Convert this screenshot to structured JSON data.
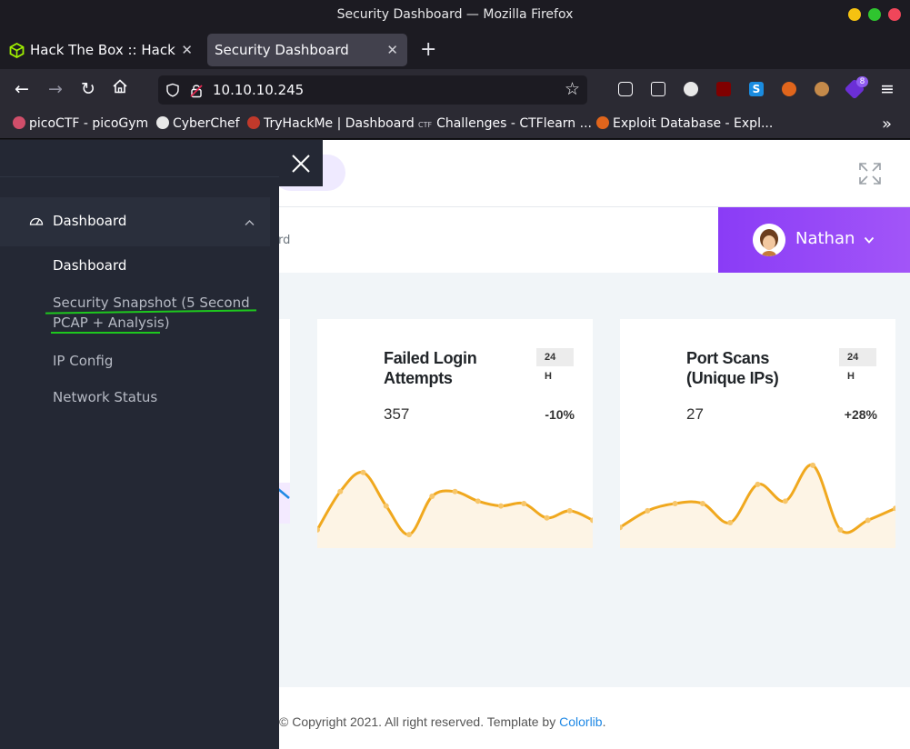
{
  "window": {
    "title": "Security Dashboard — Mozilla Firefox"
  },
  "tabs": [
    {
      "label": "Hack The Box :: Hack The"
    },
    {
      "label": "Security Dashboard"
    }
  ],
  "urlbar": {
    "url": "10.10.10.245"
  },
  "extensions": {
    "badge_count": "8"
  },
  "bookmarks": [
    {
      "label": "picoCTF - picoGym",
      "icon_color": "#d04e6a"
    },
    {
      "label": "CyberChef",
      "icon_color": "#e8e8e8"
    },
    {
      "label": "TryHackMe | Dashboard",
      "icon_color": "#c0392b"
    },
    {
      "label": "Challenges - CTFlearn ...",
      "icon_prefix": "CTF"
    },
    {
      "label": "Exploit Database - Expl...",
      "icon_color": "#e0651c"
    }
  ],
  "sidebar": {
    "section_label": "Dashboard",
    "items": [
      {
        "label": "Dashboard",
        "current": true
      },
      {
        "label_line1": "Security Snapshot (5 Second",
        "label_line2": "PCAP + Analysis)"
      },
      {
        "label": "IP Config"
      },
      {
        "label": "Network Status"
      }
    ]
  },
  "header": {
    "breadcrumb_fragment": "rd",
    "user_name": "Nathan"
  },
  "cards": [
    {
      "title": "Failed Login Attempts",
      "value": "357",
      "badge": "24",
      "badge_unit": "H",
      "delta": "-10%",
      "sparkline": [
        10,
        42,
        58,
        30,
        6,
        38,
        42,
        34,
        30,
        32,
        20,
        26,
        18
      ],
      "color": "#f0a81e"
    },
    {
      "title": "Port Scans (Unique IPs)",
      "value": "27",
      "badge": "24",
      "badge_unit": "H",
      "delta": "+28%",
      "sparkline": [
        12,
        26,
        32,
        32,
        16,
        48,
        34,
        64,
        10,
        18,
        28
      ],
      "color": "#f0a81e"
    }
  ],
  "footer": {
    "text": "© Copyright 2021. All right reserved. Template by",
    "link": "Colorlib",
    "suffix": "."
  },
  "colors": {
    "accent": "#8a3cf6",
    "sidebar": "#242834",
    "highlight_underline": "#1ec81e"
  }
}
